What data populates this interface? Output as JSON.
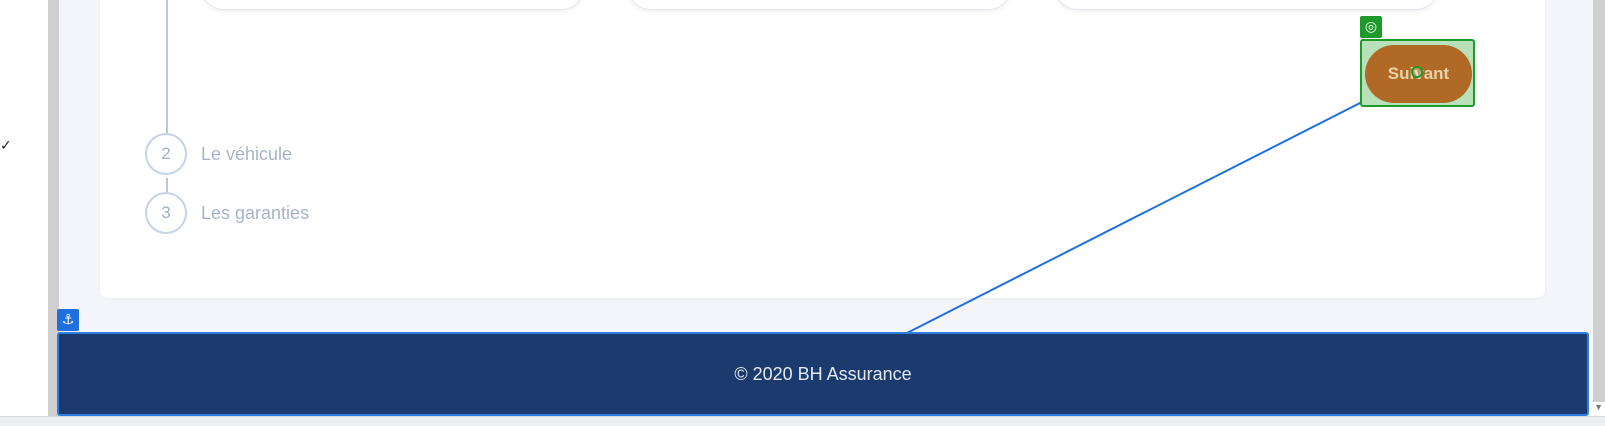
{
  "gutter": {
    "check_glyph": "✓"
  },
  "steps": [
    {
      "number": "2",
      "label": "Le véhicule"
    },
    {
      "number": "3",
      "label": "Les garanties"
    }
  ],
  "actions": {
    "next_label": "Suivant"
  },
  "annotations": {
    "target_icon": "◎",
    "anchor_icon": "⚓"
  },
  "footer": {
    "text": "© 2020 BH Assurance"
  },
  "colors": {
    "footer_bg": "#1b3a6e",
    "next_button": "#b06a26",
    "highlight_border": "#1e9a2a",
    "anchor_blue": "#1f6fe0"
  }
}
